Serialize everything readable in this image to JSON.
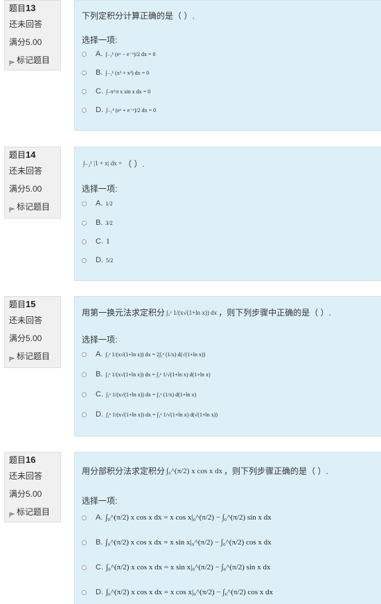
{
  "questions": [
    {
      "no_prefix": "题目",
      "no": "13",
      "status": "还未回答",
      "mark": "满分5.00",
      "flag": "标记题目",
      "text": "下列定积分计算正确的是（  ）.",
      "prompt": "选择一项:",
      "options": [
        {
          "label": "A.",
          "formula": "∫₋₁¹ (eˣ − e⁻ˣ)/2 dx = 0"
        },
        {
          "label": "B.",
          "formula": "∫₋₁¹ (x² + x³) dx = 0"
        },
        {
          "label": "C.",
          "formula": "∫₋π^π x sin x dx = 0"
        },
        {
          "label": "D.",
          "formula": "∫₋₁¹ (eˣ + e⁻ˣ)/2 dx = 0"
        }
      ]
    },
    {
      "no_prefix": "题目",
      "no": "14",
      "status": "还未回答",
      "mark": "满分5.00",
      "flag": "标记题目",
      "formula_text": "∫₋₂¹ |1 + x| dx =",
      "text": "（  ）.",
      "prompt": "选择一项:",
      "options": [
        {
          "label": "A.",
          "formula": "1/2"
        },
        {
          "label": "B.",
          "formula": "3/2"
        },
        {
          "label": "C.",
          "formula": "1"
        },
        {
          "label": "D.",
          "formula": "5/2"
        }
      ]
    },
    {
      "no_prefix": "题目",
      "no": "15",
      "status": "还未回答",
      "mark": "满分5.00",
      "flag": "标记题目",
      "text_before": "用第一换元法求定积分",
      "formula_text": "∫₁ᵉ 1/(x√(1+ln x)) dx",
      "text": "，则下列步骤中正确的是（  ）.",
      "prompt": "选择一项:",
      "options": [
        {
          "label": "A.",
          "formula": "∫₁ᵉ 1/(x√(1+ln x)) dx = 2∫₁ᵉ (1/x) d(√(1+ln x))"
        },
        {
          "label": "B.",
          "formula": "∫₁ᵉ 1/(x√(1+ln x)) dx = ∫₁ᵉ 1/√(1+ln x) d(1+ln x)"
        },
        {
          "label": "C.",
          "formula": "∫₁ᵉ 1/(x√(1+ln x)) dx = ∫₁ᵉ (1/x) d(1+ln x)"
        },
        {
          "label": "D.",
          "formula": "∫₁ᵉ 1/(x√(1+ln x)) dx = ∫₁ᵉ 1/√(1+ln x) d(√(1+ln x))"
        }
      ]
    },
    {
      "no_prefix": "题目",
      "no": "16",
      "status": "还未回答",
      "mark": "满分5.00",
      "flag": "标记题目",
      "text_before": "用分部积分法求定积分",
      "formula_text": "∫₀^(π/2) x cos x dx",
      "text": "，则下列步骤正确的是（  ）.",
      "prompt": "选择一项:",
      "options": [
        {
          "label": "A.",
          "formula": "∫₀^(π/2) x cos x dx = x cos x|₀^(π/2) − ∫₀^(π/2) sin x dx"
        },
        {
          "label": "B.",
          "formula": "∫₀^(π/2) x cos x dx = x sin x|₀^(π/2) − ∫₀^(π/2) cos x dx"
        },
        {
          "label": "C.",
          "formula": "∫₀^(π/2) x cos x dx = x sin x|₀^(π/2) − ∫₀^(π/2) sin x dx"
        },
        {
          "label": "D.",
          "formula": "∫₀^(π/2) x cos x dx = x cos x|₀^(π/2) − ∫₀^(π/2) cos x dx"
        }
      ]
    }
  ],
  "colors": {
    "info_bg": "#f0f0f0",
    "content_bg": "#def0f7",
    "content_border": "#c8e1ee"
  },
  "icons": {
    "flag": "flag-icon",
    "radio": "radio-button"
  }
}
